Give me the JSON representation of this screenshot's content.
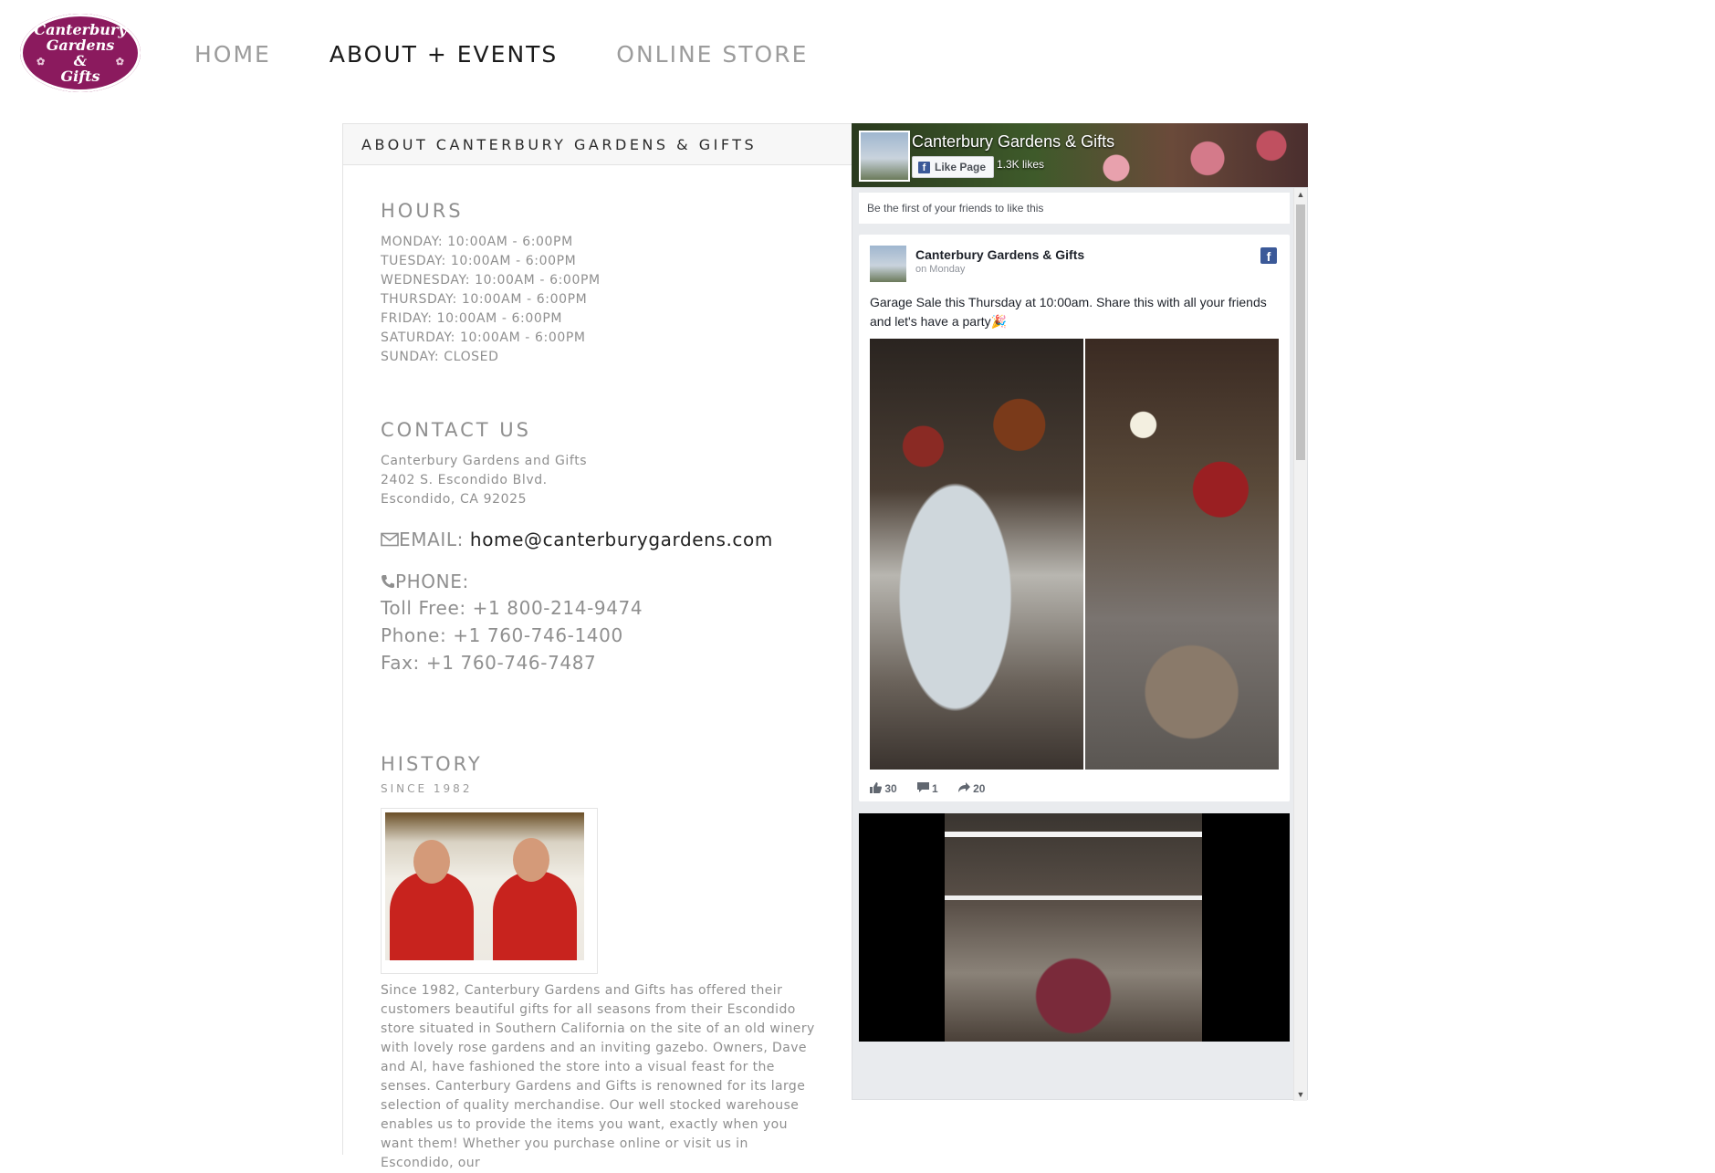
{
  "logo": {
    "line1": "Canterbury",
    "line2": "Gardens",
    "line3": "&",
    "line4": "Gifts"
  },
  "nav": {
    "items": [
      "HOME",
      "ABOUT + EVENTS",
      "ONLINE STORE"
    ],
    "active": "ABOUT + EVENTS"
  },
  "about": {
    "panel_title": "ABOUT CANTERBURY GARDENS & GIFTS",
    "hours": {
      "title": "HOURS",
      "lines": [
        "MONDAY: 10:00AM - 6:00PM",
        "TUESDAY: 10:00AM - 6:00PM",
        "WEDNESDAY: 10:00AM - 6:00PM",
        "THURSDAY: 10:00AM - 6:00PM",
        "FRIDAY: 10:00AM - 6:00PM",
        "SATURDAY: 10:00AM - 6:00PM",
        "SUNDAY: CLOSED"
      ]
    },
    "contact": {
      "title": "CONTACT US",
      "address": [
        "Canterbury Gardens and Gifts",
        "2402 S. Escondido Blvd.",
        "Escondido, CA 92025"
      ],
      "email_label": "EMAIL: ",
      "email_value": "home@canterburygardens.com",
      "phone_label": "PHONE:",
      "phones": [
        "Toll Free: +1 800-214-9474",
        "Phone: +1 760-746-1400",
        "Fax: +1 760-746-7487"
      ]
    },
    "history": {
      "title": "HISTORY",
      "subtitle": "SINCE 1982",
      "text": "Since 1982, Canterbury Gardens and Gifts has offered their customers beautiful gifts for all seasons from their Escondido store situated in Southern California on the site of an old winery with lovely rose gardens and an inviting gazebo. Owners, Dave and Al, have fashioned the store into a visual feast for the senses. Canterbury Gardens and Gifts is renowned for its large selection of quality merchandise. Our well stocked warehouse enables us to provide the items you want, exactly when you want them! Whether you purchase online or visit us in Escondido, our"
    }
  },
  "facebook": {
    "page_name": "Canterbury Gardens & Gifts",
    "like_button": "Like Page",
    "likes": "1.3K likes",
    "friends_text": "Be the first of your friends to like this",
    "post": {
      "author": "Canterbury Gardens & Gifts",
      "time": "on Monday",
      "text": "Garage Sale this Thursday at 10:00am. Share this with all your friends and let's have a party🎉",
      "likes": "30",
      "comments": "1",
      "shares": "20"
    }
  },
  "icons": {
    "email": "envelope-icon",
    "phone": "phone-icon",
    "like": "thumbs-up-icon",
    "comment": "comment-icon",
    "share": "share-icon"
  },
  "colors": {
    "brand": "#8b1a5e",
    "facebook": "#3b5998"
  }
}
